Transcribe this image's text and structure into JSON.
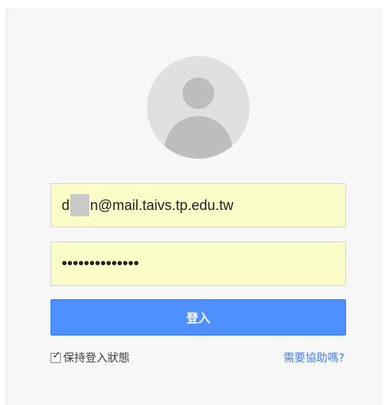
{
  "login": {
    "email_prefix": "d",
    "email_suffix": "n@mail.taivs.tp.edu.tw",
    "password_masked": "••••••••••••••",
    "signin_label": "登入",
    "stay_signed_in_label": "保持登入狀態",
    "stay_signed_in_checked": true,
    "help_link": "需要協助嗎?"
  },
  "colors": {
    "button": "#4d90fe",
    "field_autofill": "#fafdc7",
    "link": "#427fed"
  }
}
